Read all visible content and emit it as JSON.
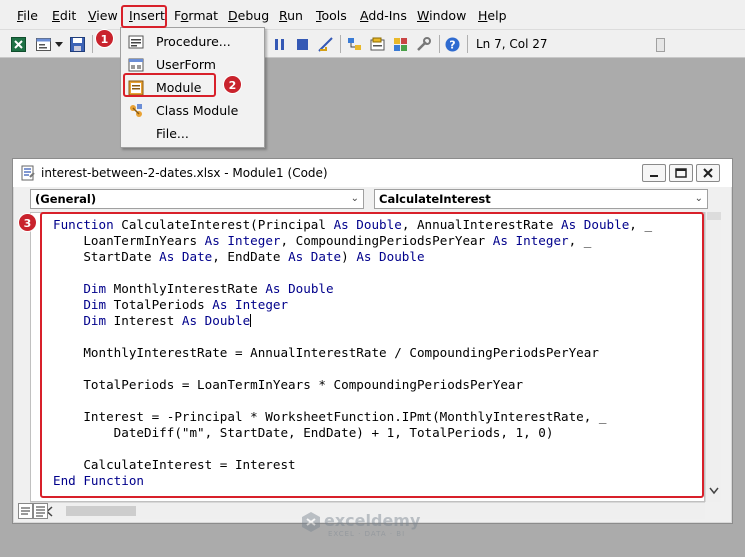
{
  "menu": {
    "items": [
      "File",
      "Edit",
      "View",
      "Insert",
      "Format",
      "Debug",
      "Run",
      "Tools",
      "Add-Ins",
      "Window",
      "Help"
    ],
    "underline": [
      "F",
      "E",
      "V",
      "I",
      "o",
      "D",
      "R",
      "T",
      "A",
      "W",
      "H"
    ]
  },
  "toolbar": {
    "status": "Ln 7, Col 27"
  },
  "insert_menu": {
    "items": [
      "Procedure...",
      "UserForm",
      "Module",
      "Class Module",
      "File..."
    ]
  },
  "badges": [
    "1",
    "2",
    "3"
  ],
  "colors": {
    "highlight": "#d8202a",
    "badge": "#c9232d",
    "keyword": "#00008b"
  },
  "code_window": {
    "title": "interest-between-2-dates.xlsx - Module1 (Code)",
    "object_combo": "(General)",
    "proc_combo": "CalculateInterest",
    "lines": [
      [
        [
          "kw",
          "Function"
        ],
        [
          "t",
          " CalculateInterest(Principal "
        ],
        [
          "kw",
          "As Double"
        ],
        [
          "t",
          ", AnnualInterestRate "
        ],
        [
          "kw",
          "As Double"
        ],
        [
          "t",
          ", _"
        ]
      ],
      [
        [
          "t",
          "    LoanTermInYears "
        ],
        [
          "kw",
          "As Integer"
        ],
        [
          "t",
          ", CompoundingPeriodsPerYear "
        ],
        [
          "kw",
          "As Integer"
        ],
        [
          "t",
          ", _"
        ]
      ],
      [
        [
          "t",
          "    StartDate "
        ],
        [
          "kw",
          "As Date"
        ],
        [
          "t",
          ", EndDate "
        ],
        [
          "kw",
          "As Date"
        ],
        [
          "t",
          ") "
        ],
        [
          "kw",
          "As Double"
        ]
      ],
      [],
      [
        [
          "t",
          "    "
        ],
        [
          "kw",
          "Dim"
        ],
        [
          "t",
          " MonthlyInterestRate "
        ],
        [
          "kw",
          "As Double"
        ]
      ],
      [
        [
          "t",
          "    "
        ],
        [
          "kw",
          "Dim"
        ],
        [
          "t",
          " TotalPeriods "
        ],
        [
          "kw",
          "As Integer"
        ]
      ],
      [
        [
          "t",
          "    "
        ],
        [
          "kw",
          "Dim"
        ],
        [
          "t",
          " Interest "
        ],
        [
          "kw",
          "As Double"
        ],
        [
          "caret",
          ""
        ]
      ],
      [],
      [
        [
          "t",
          "    MonthlyInterestRate = AnnualInterestRate / CompoundingPeriodsPerYear"
        ]
      ],
      [],
      [
        [
          "t",
          "    TotalPeriods = LoanTermInYears * CompoundingPeriodsPerYear"
        ]
      ],
      [],
      [
        [
          "t",
          "    Interest = -Principal * WorksheetFunction.IPmt(MonthlyInterestRate, _"
        ]
      ],
      [
        [
          "t",
          "        DateDiff(\"m\", StartDate, EndDate) + 1, TotalPeriods, 1, 0)"
        ]
      ],
      [],
      [
        [
          "t",
          "    CalculateInterest = Interest"
        ]
      ],
      [
        [
          "kw",
          "End Function"
        ]
      ]
    ]
  },
  "watermark": {
    "name": "exceldemy",
    "tagline": "EXCEL · DATA · BI"
  }
}
